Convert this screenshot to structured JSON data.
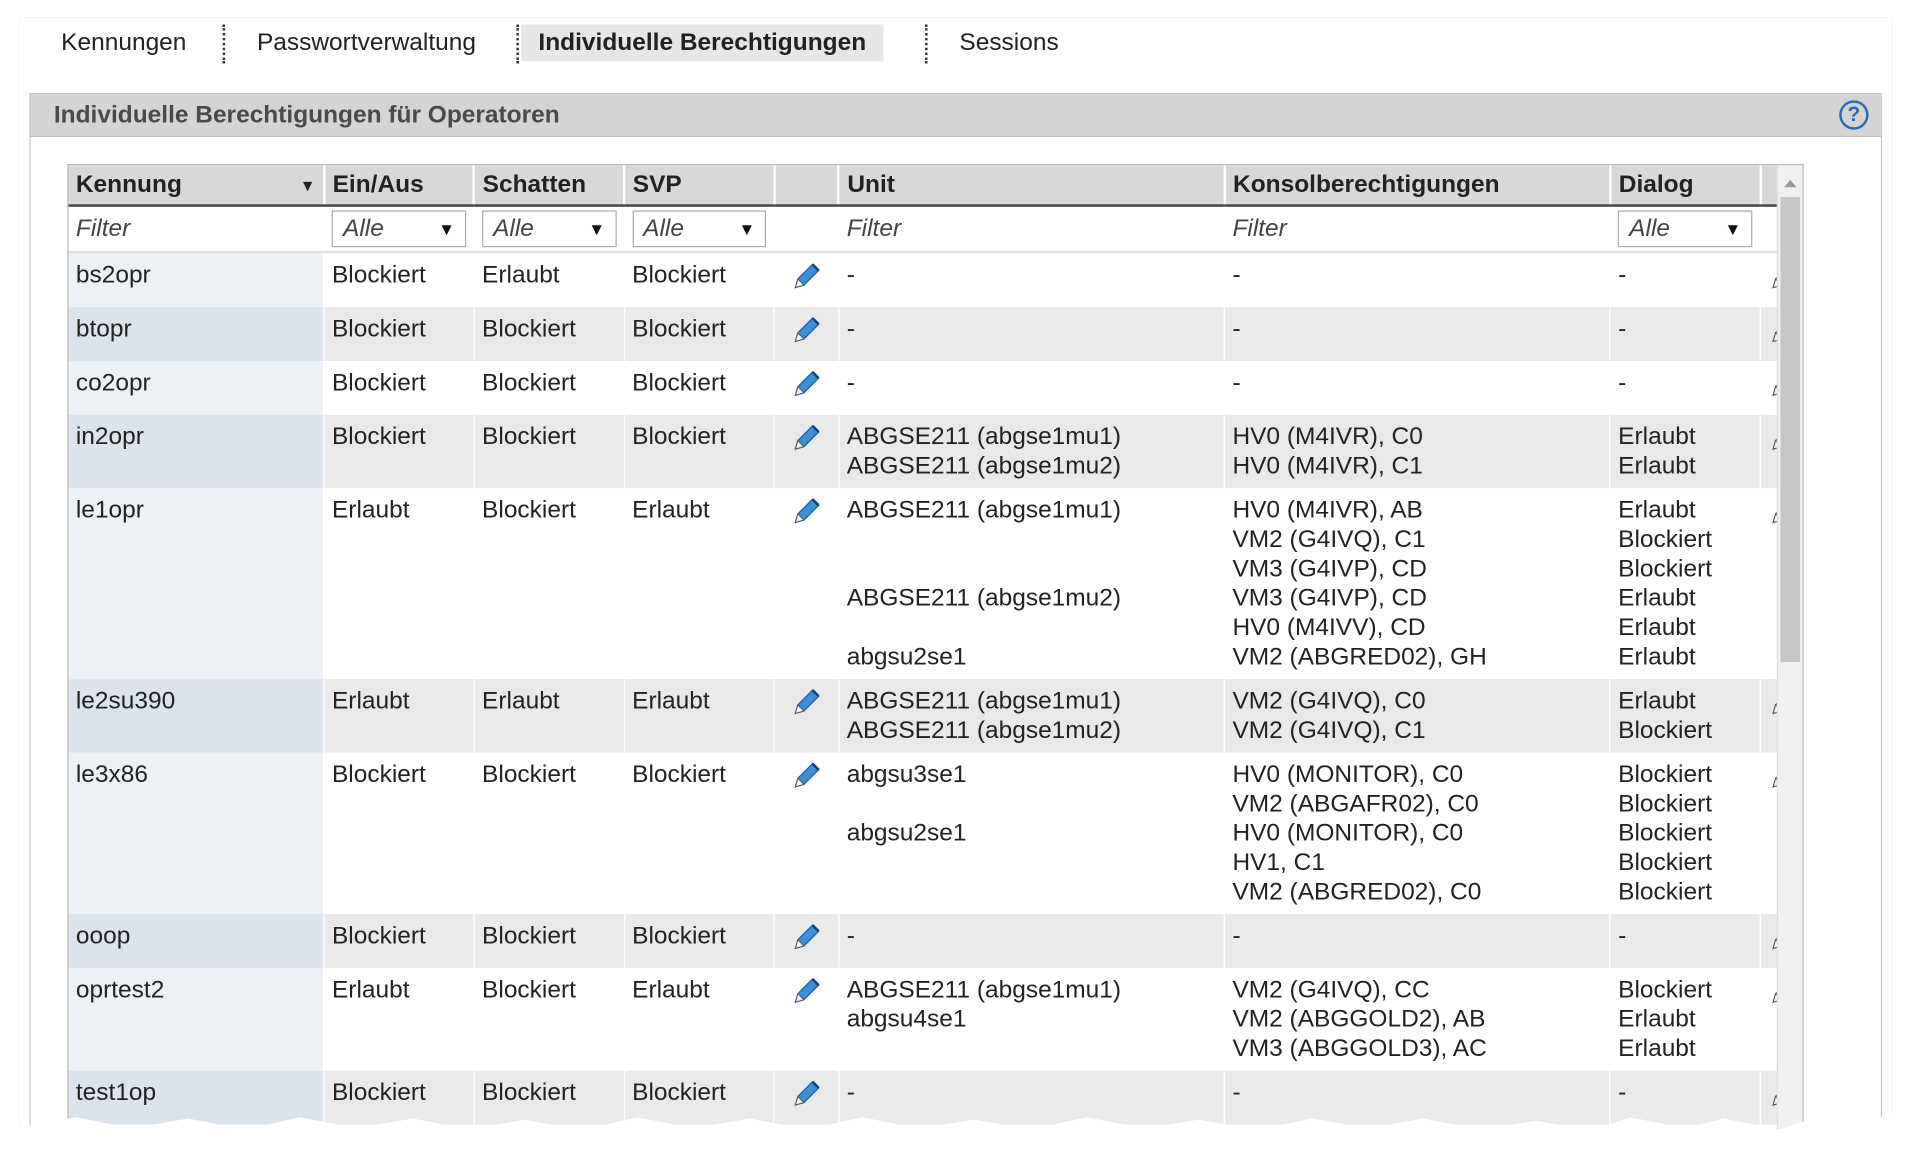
{
  "tabs": [
    {
      "label": "Kennungen"
    },
    {
      "label": "Passwortverwaltung"
    },
    {
      "label": "Individuelle Berechtigungen"
    },
    {
      "label": "Sessions"
    }
  ],
  "panel": {
    "title": "Individuelle Berechtigungen für Operatoren",
    "help_icon": "help-icon"
  },
  "table": {
    "columns": [
      "Kennung",
      "Ein/Aus",
      "Schatten",
      "SVP",
      "",
      "Unit",
      "Konsolberechtigungen",
      "Dialog",
      ""
    ],
    "filters": {
      "kennung": "Filter",
      "einaus": "Alle",
      "schatten": "Alle",
      "svp": "Alle",
      "unit": "Filter",
      "konsol": "Filter",
      "dialog": "Alle"
    },
    "rows": [
      {
        "kennung": "bs2opr",
        "einaus": "Blockiert",
        "schatten": "Erlaubt",
        "svp": "Blockiert",
        "unit": [
          "-"
        ],
        "konsol": [
          "-"
        ],
        "dialog": [
          "-"
        ]
      },
      {
        "kennung": "btopr",
        "einaus": "Blockiert",
        "schatten": "Blockiert",
        "svp": "Blockiert",
        "unit": [
          "-"
        ],
        "konsol": [
          "-"
        ],
        "dialog": [
          "-"
        ]
      },
      {
        "kennung": "co2opr",
        "einaus": "Blockiert",
        "schatten": "Blockiert",
        "svp": "Blockiert",
        "unit": [
          "-"
        ],
        "konsol": [
          "-"
        ],
        "dialog": [
          "-"
        ]
      },
      {
        "kennung": "in2opr",
        "einaus": "Blockiert",
        "schatten": "Blockiert",
        "svp": "Blockiert",
        "unit": [
          "ABGSE211 (abgse1mu1)",
          "ABGSE211 (abgse1mu2)"
        ],
        "konsol": [
          "HV0 (M4IVR), C0",
          "HV0 (M4IVR), C1"
        ],
        "dialog": [
          "Erlaubt",
          "Erlaubt"
        ]
      },
      {
        "kennung": "le1opr",
        "einaus": "Erlaubt",
        "schatten": "Blockiert",
        "svp": "Erlaubt",
        "unit": [
          "ABGSE211 (abgse1mu1)",
          "",
          "",
          "ABGSE211 (abgse1mu2)",
          "",
          "abgsu2se1"
        ],
        "konsol": [
          "HV0 (M4IVR), AB",
          "VM2 (G4IVQ), C1",
          "VM3 (G4IVP), CD",
          "VM3 (G4IVP), CD",
          "HV0 (M4IVV), CD",
          "VM2 (ABGRED02), GH"
        ],
        "dialog": [
          "Erlaubt",
          "Blockiert",
          "Blockiert",
          "Erlaubt",
          "Erlaubt",
          "Erlaubt"
        ]
      },
      {
        "kennung": "le2su390",
        "einaus": "Erlaubt",
        "schatten": "Erlaubt",
        "svp": "Erlaubt",
        "unit": [
          "ABGSE211 (abgse1mu1)",
          "ABGSE211 (abgse1mu2)"
        ],
        "konsol": [
          "VM2 (G4IVQ), C0",
          "VM2 (G4IVQ), C1"
        ],
        "dialog": [
          "Erlaubt",
          "Blockiert"
        ]
      },
      {
        "kennung": "le3x86",
        "einaus": "Blockiert",
        "schatten": "Blockiert",
        "svp": "Blockiert",
        "unit": [
          "abgsu3se1",
          "",
          "abgsu2se1"
        ],
        "konsol": [
          "HV0 (MONITOR), C0",
          "VM2 (ABGAFR02), C0",
          "HV0 (MONITOR), C0",
          "HV1, C1",
          "VM2 (ABGRED02), C0"
        ],
        "dialog": [
          "Blockiert",
          "Blockiert",
          "Blockiert",
          "Blockiert",
          "Blockiert"
        ]
      },
      {
        "kennung": "ooop",
        "einaus": "Blockiert",
        "schatten": "Blockiert",
        "svp": "Blockiert",
        "unit": [
          "-"
        ],
        "konsol": [
          "-"
        ],
        "dialog": [
          "-"
        ]
      },
      {
        "kennung": "oprtest2",
        "einaus": "Erlaubt",
        "schatten": "Blockiert",
        "svp": "Erlaubt",
        "unit": [
          "ABGSE211 (abgse1mu1)",
          "abgsu4se1"
        ],
        "konsol": [
          "VM2 (G4IVQ), CC",
          "VM2 (ABGGOLD2), AB",
          "VM3 (ABGGOLD3), AC"
        ],
        "dialog": [
          "Blockiert",
          "Erlaubt",
          "Erlaubt"
        ]
      },
      {
        "kennung": "test1op",
        "einaus": "Blockiert",
        "schatten": "Blockiert",
        "svp": "Blockiert",
        "unit": [
          "-"
        ],
        "konsol": [
          "-"
        ],
        "dialog": [
          "-"
        ]
      }
    ]
  },
  "colors": {
    "accent": "#2a6ab8",
    "header_bg": "#d8d8d8",
    "panel_header_bg": "#d4d4d4"
  }
}
